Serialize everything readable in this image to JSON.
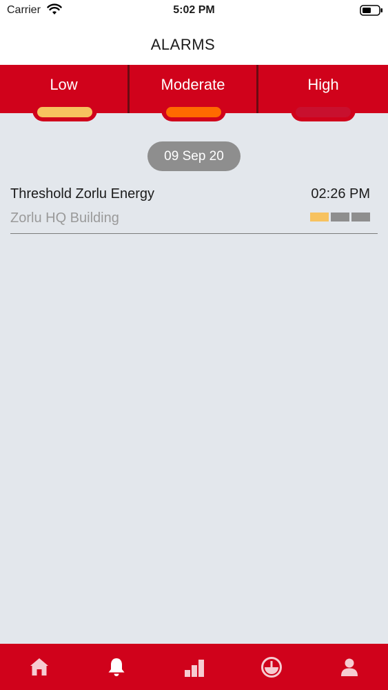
{
  "status_bar": {
    "carrier": "Carrier",
    "time": "5:02 PM"
  },
  "header": {
    "title": "ALARMS"
  },
  "level_tabs": [
    {
      "label": "Low",
      "color": "#f7c25f"
    },
    {
      "label": "Moderate",
      "color": "#ff6a00"
    },
    {
      "label": "High",
      "color": "#c8102e"
    }
  ],
  "alarms": {
    "date": "09 Sep 20",
    "items": [
      {
        "title": "Threshold Zorlu Energy",
        "time": "02:26 PM",
        "location": "Zorlu HQ Building",
        "severity": "Low",
        "severity_level": 1,
        "severity_levels_total": 3
      }
    ]
  },
  "bottom_tabs": [
    {
      "icon": "home-icon"
    },
    {
      "icon": "bell-icon"
    },
    {
      "icon": "bar-chart-icon"
    },
    {
      "icon": "gauge-icon"
    },
    {
      "icon": "user-icon"
    }
  ],
  "colors": {
    "brand_red": "#d0021b",
    "background": "#e3e7ec",
    "severity_active": "#f7c25f",
    "severity_inactive": "#8e8e8e"
  }
}
